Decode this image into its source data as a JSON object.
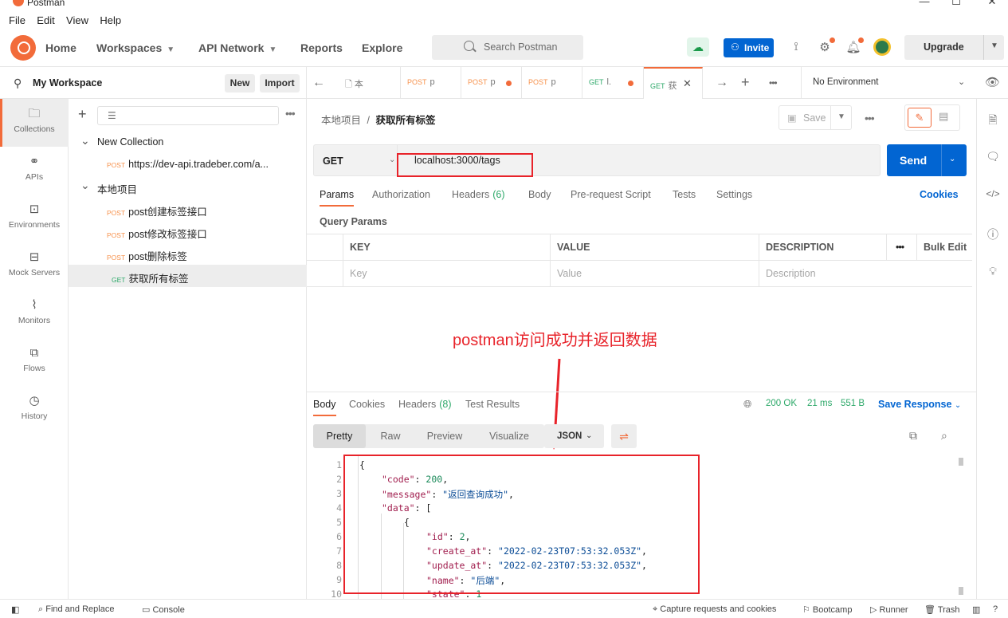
{
  "window": {
    "title": "Postman",
    "controls": [
      "—",
      "☐",
      "✕"
    ]
  },
  "menu": [
    "File",
    "Edit",
    "View",
    "Help"
  ],
  "header": {
    "nav": [
      {
        "label": "Home",
        "chevron": false
      },
      {
        "label": "Workspaces",
        "chevron": true
      },
      {
        "label": "API Network",
        "chevron": true
      },
      {
        "label": "Reports",
        "chevron": false
      },
      {
        "label": "Explore",
        "chevron": false
      }
    ],
    "search_placeholder": "Search Postman",
    "invite_label": "Invite",
    "upgrade_label": "Upgrade"
  },
  "workspace": {
    "name": "My Workspace",
    "new_label": "New",
    "import_label": "Import"
  },
  "rail": [
    {
      "label": "Collections",
      "icon": "collections-icon",
      "glyph": "🗀"
    },
    {
      "label": "APIs",
      "icon": "apis-icon",
      "glyph": "⚭"
    },
    {
      "label": "Environments",
      "icon": "environments-icon",
      "glyph": "⊡"
    },
    {
      "label": "Mock Servers",
      "icon": "mock-servers-icon",
      "glyph": "⊟"
    },
    {
      "label": "Monitors",
      "icon": "monitors-icon",
      "glyph": "⌇"
    },
    {
      "label": "Flows",
      "icon": "flows-icon",
      "glyph": "⧉"
    },
    {
      "label": "History",
      "icon": "history-icon",
      "glyph": "◷"
    }
  ],
  "tree": [
    {
      "type": "folder",
      "label": "New Collection",
      "indent": 0,
      "method": ""
    },
    {
      "type": "request",
      "label": "https://dev-api.tradeber.com/a...",
      "indent": 1,
      "method": "POST"
    },
    {
      "type": "folder",
      "label": "本地项目",
      "indent": 0,
      "method": ""
    },
    {
      "type": "request",
      "label": "post创建标签接口",
      "indent": 1,
      "method": "POST"
    },
    {
      "type": "request",
      "label": "post修改标签接口",
      "indent": 1,
      "method": "POST"
    },
    {
      "type": "request",
      "label": "post删除标签",
      "indent": 1,
      "method": "POST"
    },
    {
      "type": "request",
      "label": "获取所有标签",
      "indent": 1,
      "method": "GET",
      "selected": true
    }
  ],
  "tabs": [
    {
      "method": "",
      "label": "本",
      "dot": false
    },
    {
      "method": "POST",
      "label": "p",
      "dot": false
    },
    {
      "method": "POST",
      "label": "p",
      "dot": true
    },
    {
      "method": "POST",
      "label": "p",
      "dot": false
    },
    {
      "method": "GET",
      "label": "l.",
      "dot": true
    },
    {
      "method": "GET",
      "label": "获",
      "dot": false,
      "active": true
    }
  ],
  "environment": "No Environment",
  "request": {
    "breadcrumb_parent": "本地项目",
    "breadcrumb_sep": "/",
    "breadcrumb_current": "获取所有标签",
    "save_label": "Save",
    "method": "GET",
    "url": "localhost:3000/tags",
    "send_label": "Send",
    "tabs": [
      {
        "label": "Params",
        "count": ""
      },
      {
        "label": "Authorization",
        "count": ""
      },
      {
        "label": "Headers",
        "count": "(6)"
      },
      {
        "label": "Body",
        "count": ""
      },
      {
        "label": "Pre-request Script",
        "count": ""
      },
      {
        "label": "Tests",
        "count": ""
      },
      {
        "label": "Settings",
        "count": ""
      }
    ],
    "cookies_label": "Cookies",
    "query_params_title": "Query Params",
    "params_headers": {
      "key": "KEY",
      "value": "VALUE",
      "description": "DESCRIPTION",
      "bulk": "Bulk Edit"
    },
    "params_placeholders": {
      "key": "Key",
      "value": "Value",
      "description": "Description"
    }
  },
  "annotation": "postman访问成功并返回数据",
  "response": {
    "tabs": [
      {
        "label": "Body",
        "count": ""
      },
      {
        "label": "Cookies",
        "count": ""
      },
      {
        "label": "Headers",
        "count": "(8)"
      },
      {
        "label": "Test Results",
        "count": ""
      }
    ],
    "status": "200 OK",
    "time": "21 ms",
    "size": "551 B",
    "save_label": "Save Response",
    "formats": [
      "Pretty",
      "Raw",
      "Preview",
      "Visualize"
    ],
    "format_type": "JSON",
    "lines": [
      {
        "n": "1",
        "indent": 0,
        "parts": [
          [
            "p",
            "{"
          ]
        ]
      },
      {
        "n": "2",
        "indent": 1,
        "parts": [
          [
            "k",
            "\"code\""
          ],
          [
            "p",
            ": "
          ],
          [
            "n",
            "200"
          ],
          [
            "p",
            ","
          ]
        ]
      },
      {
        "n": "3",
        "indent": 1,
        "parts": [
          [
            "k",
            "\"message\""
          ],
          [
            "p",
            ": "
          ],
          [
            "s",
            "\"返回查询成功\""
          ],
          [
            "p",
            ","
          ]
        ]
      },
      {
        "n": "4",
        "indent": 1,
        "parts": [
          [
            "k",
            "\"data\""
          ],
          [
            "p",
            ": ["
          ]
        ]
      },
      {
        "n": "5",
        "indent": 2,
        "parts": [
          [
            "p",
            "{"
          ]
        ]
      },
      {
        "n": "6",
        "indent": 3,
        "parts": [
          [
            "k",
            "\"id\""
          ],
          [
            "p",
            ": "
          ],
          [
            "n",
            "2"
          ],
          [
            "p",
            ","
          ]
        ]
      },
      {
        "n": "7",
        "indent": 3,
        "parts": [
          [
            "k",
            "\"create_at\""
          ],
          [
            "p",
            ": "
          ],
          [
            "s",
            "\"2022-02-23T07:53:32.053Z\""
          ],
          [
            "p",
            ","
          ]
        ]
      },
      {
        "n": "8",
        "indent": 3,
        "parts": [
          [
            "k",
            "\"update_at\""
          ],
          [
            "p",
            ": "
          ],
          [
            "s",
            "\"2022-02-23T07:53:32.053Z\""
          ],
          [
            "p",
            ","
          ]
        ]
      },
      {
        "n": "9",
        "indent": 3,
        "parts": [
          [
            "k",
            "\"name\""
          ],
          [
            "p",
            ": "
          ],
          [
            "s",
            "\"后端\""
          ],
          [
            "p",
            ","
          ]
        ]
      },
      {
        "n": "10",
        "indent": 3,
        "parts": [
          [
            "k",
            "\"state\""
          ],
          [
            "p",
            ": "
          ],
          [
            "n",
            "1"
          ]
        ]
      }
    ]
  },
  "statusbar": {
    "find_replace": "Find and Replace",
    "console": "Console",
    "capture": "Capture requests and cookies",
    "bootcamp": "Bootcamp",
    "runner": "Runner",
    "trash": "Trash"
  },
  "colors": {
    "accent": "#f26b3a",
    "primary": "#0265d2",
    "annotation": "#e8232a",
    "get": "#2ea96a",
    "post": "#f7924d"
  }
}
